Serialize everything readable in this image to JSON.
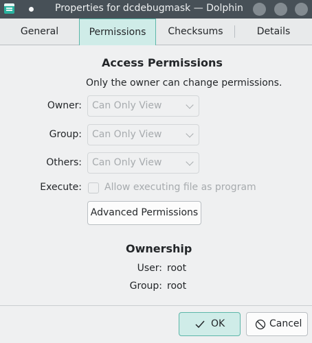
{
  "window": {
    "title": "Properties for dcdebugmask — Dolphin",
    "app_icon": "dolphin-icon",
    "buttons": [
      "minimize-button",
      "maximize-button",
      "close-button"
    ]
  },
  "tabs": [
    {
      "label": "General",
      "active": false
    },
    {
      "label": "Permissions",
      "active": true
    },
    {
      "label": "Checksums",
      "active": false
    },
    {
      "label": "Details",
      "active": false
    }
  ],
  "access": {
    "heading": "Access Permissions",
    "note": "Only the owner can change permissions.",
    "owner_label": "Owner:",
    "owner_value": "Can Only View",
    "group_label": "Group:",
    "group_value": "Can Only View",
    "others_label": "Others:",
    "others_value": "Can Only View",
    "execute_label": "Execute:",
    "execute_checkbox_label": "Allow executing file as program",
    "execute_checked": false,
    "advanced_button": "Advanced Permissions"
  },
  "ownership": {
    "heading": "Ownership",
    "user_label": "User:",
    "user_value": "root",
    "group_label": "Group:",
    "group_value": "root"
  },
  "footer": {
    "ok_label": "OK",
    "ok_icon": "checkmark-icon",
    "cancel_label": "Cancel",
    "cancel_icon": "cancel-icon"
  },
  "colors": {
    "accent": "#5cb6a8",
    "accent_fill": "#cfece8",
    "titlebar": "#475057"
  }
}
